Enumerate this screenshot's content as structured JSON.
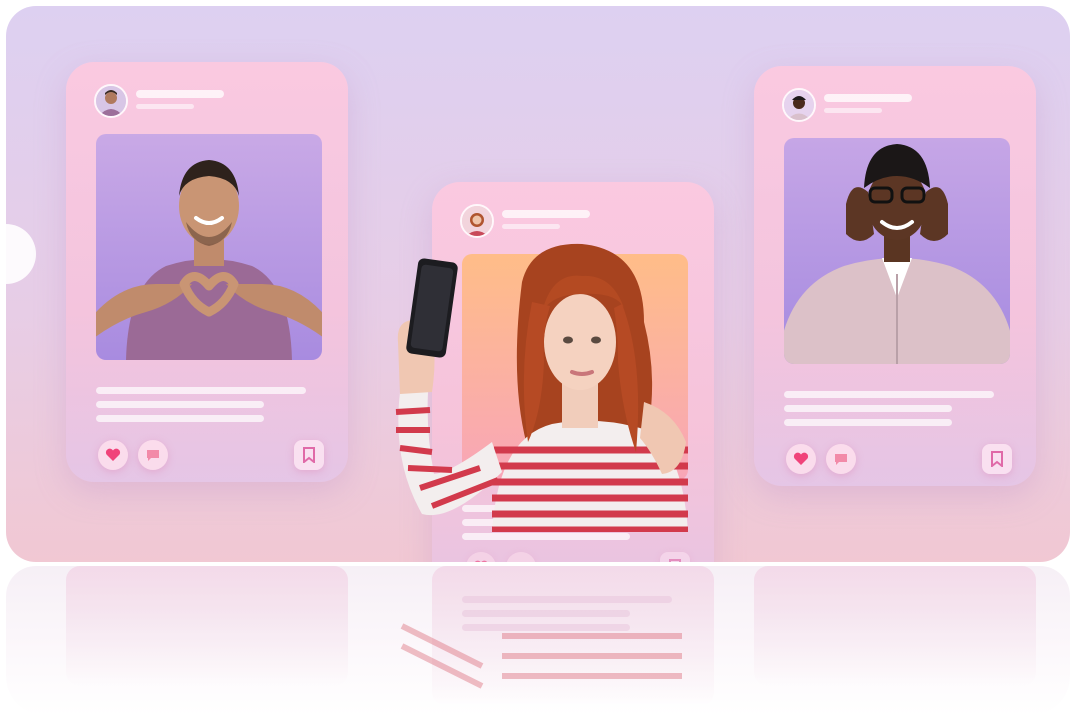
{
  "scene": {
    "description_labels": [],
    "colors": {
      "background_top": "#ddd0f1",
      "background_bottom": "#f1c8d3",
      "card_tint": "#ffc8de",
      "heart": "#f0437a",
      "comment": "#f28aa8",
      "bookmark": "#e06aa8"
    }
  },
  "cards": [
    {
      "name": "left-post",
      "person": "smiling-man-heart-hands",
      "actions": [
        "heart-icon",
        "comment-icon",
        "bookmark-icon"
      ]
    },
    {
      "name": "center-post",
      "person": "red-haired-woman-selfie",
      "actions": [
        "heart-icon",
        "comment-icon",
        "bookmark-icon"
      ]
    },
    {
      "name": "right-post",
      "person": "man-with-headphones",
      "actions": [
        "heart-icon",
        "comment-icon",
        "bookmark-icon"
      ]
    }
  ]
}
